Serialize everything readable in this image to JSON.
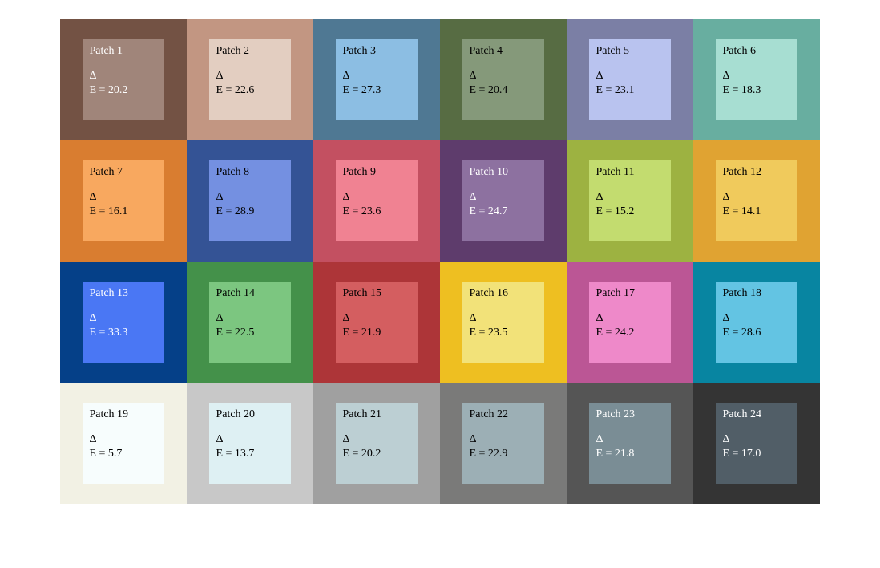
{
  "chart_data": {
    "type": "table",
    "title": "",
    "patches": [
      {
        "id": 1,
        "label": "Patch 1",
        "deltaE": 20.2,
        "outer": "#735244",
        "inner": "#a0857a",
        "text": "#ffffff"
      },
      {
        "id": 2,
        "label": "Patch 2",
        "deltaE": 22.6,
        "outer": "#c29682",
        "inner": "#e3cec1",
        "text": "#000000"
      },
      {
        "id": 3,
        "label": "Patch 3",
        "deltaE": 27.3,
        "outer": "#4f7893",
        "inner": "#8cbee3",
        "text": "#000000"
      },
      {
        "id": 4,
        "label": "Patch 4",
        "deltaE": 20.4,
        "outer": "#576c43",
        "inner": "#85997a",
        "text": "#000000"
      },
      {
        "id": 5,
        "label": "Patch 5",
        "deltaE": 23.1,
        "outer": "#7b7fa5",
        "inner": "#b9c3ef",
        "text": "#000000"
      },
      {
        "id": 6,
        "label": "Patch 6",
        "deltaE": 18.3,
        "outer": "#68aea0",
        "inner": "#a7ded2",
        "text": "#000000"
      },
      {
        "id": 7,
        "label": "Patch 7",
        "deltaE": 16.1,
        "outer": "#d97d30",
        "inner": "#f8a85f",
        "text": "#000000"
      },
      {
        "id": 8,
        "label": "Patch 8",
        "deltaE": 28.9,
        "outer": "#345395",
        "inner": "#7490e1",
        "text": "#000000"
      },
      {
        "id": 9,
        "label": "Patch 9",
        "deltaE": 23.6,
        "outer": "#c35061",
        "inner": "#f08292",
        "text": "#000000"
      },
      {
        "id": 10,
        "label": "Patch 10",
        "deltaE": 24.7,
        "outer": "#5e3c6c",
        "inner": "#8d71a0",
        "text": "#ffffff"
      },
      {
        "id": 11,
        "label": "Patch 11",
        "deltaE": 15.2,
        "outer": "#9db241",
        "inner": "#c3dc6f",
        "text": "#000000"
      },
      {
        "id": 12,
        "label": "Patch 12",
        "deltaE": 14.1,
        "outer": "#e0a332",
        "inner": "#f0ca5c",
        "text": "#000000"
      },
      {
        "id": 13,
        "label": "Patch 13",
        "deltaE": 33.3,
        "outer": "#054088",
        "inner": "#4a77f4",
        "text": "#ffffff"
      },
      {
        "id": 14,
        "label": "Patch 14",
        "deltaE": 22.5,
        "outer": "#44914a",
        "inner": "#7cc680",
        "text": "#000000"
      },
      {
        "id": 15,
        "label": "Patch 15",
        "deltaE": 21.9,
        "outer": "#ad3538",
        "inner": "#d45e60",
        "text": "#000000"
      },
      {
        "id": 16,
        "label": "Patch 16",
        "deltaE": 23.5,
        "outer": "#eebf21",
        "inner": "#f2e279",
        "text": "#000000"
      },
      {
        "id": 17,
        "label": "Patch 17",
        "deltaE": 24.2,
        "outer": "#bb5695",
        "inner": "#ee89c9",
        "text": "#000000"
      },
      {
        "id": 18,
        "label": "Patch 18",
        "deltaE": 28.6,
        "outer": "#0885a1",
        "inner": "#63c4e3",
        "text": "#000000"
      },
      {
        "id": 19,
        "label": "Patch 19",
        "deltaE": 5.7,
        "outer": "#f2f1e4",
        "inner": "#f7fdfd",
        "text": "#000000"
      },
      {
        "id": 20,
        "label": "Patch 20",
        "deltaE": 13.7,
        "outer": "#c8c8c8",
        "inner": "#def0f3",
        "text": "#000000"
      },
      {
        "id": 21,
        "label": "Patch 21",
        "deltaE": 20.2,
        "outer": "#a0a0a0",
        "inner": "#bccfd3",
        "text": "#000000"
      },
      {
        "id": 22,
        "label": "Patch 22",
        "deltaE": 22.9,
        "outer": "#7a7a79",
        "inner": "#9cafb5",
        "text": "#000000"
      },
      {
        "id": 23,
        "label": "Patch 23",
        "deltaE": 21.8,
        "outer": "#555555",
        "inner": "#7a8d95",
        "text": "#ffffff"
      },
      {
        "id": 24,
        "label": "Patch 24",
        "deltaE": 17.0,
        "outer": "#343434",
        "inner": "#515e67",
        "text": "#ffffff"
      }
    ],
    "delta_symbol": "Δ",
    "value_prefix": "E = "
  }
}
